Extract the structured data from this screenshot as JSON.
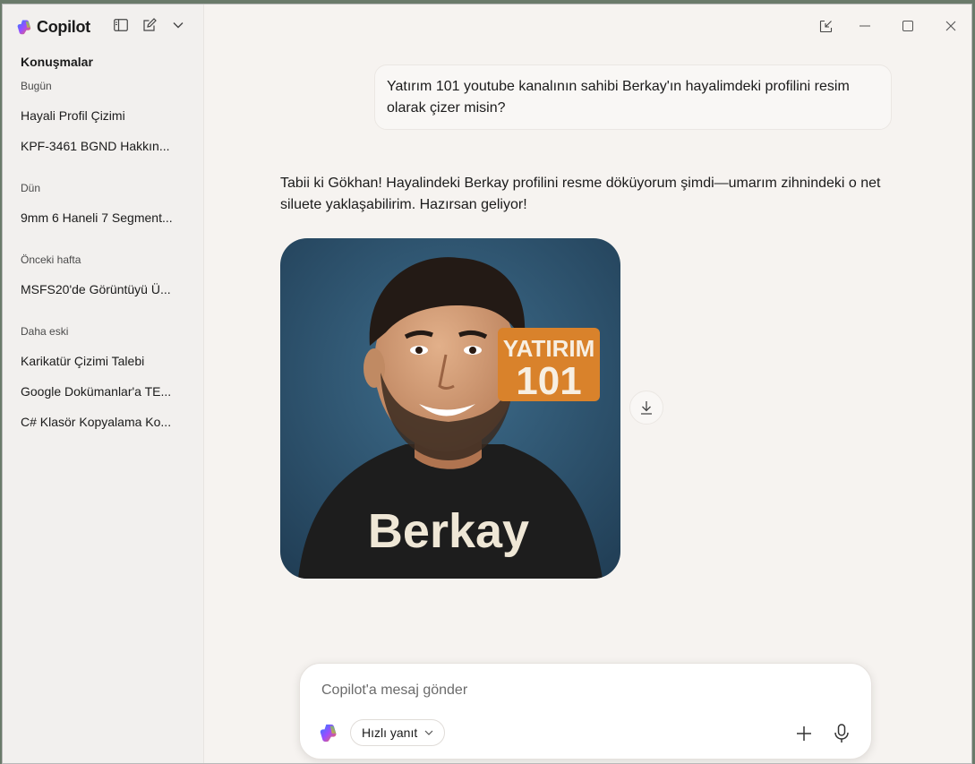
{
  "app": {
    "name": "Copilot"
  },
  "sidebar": {
    "heading": "Konuşmalar",
    "groups": [
      {
        "label": "Bugün",
        "items": [
          "Hayali Profil Çizimi",
          "KPF-3461 BGND Hakkın..."
        ]
      },
      {
        "label": "Dün",
        "items": [
          "9mm 6 Haneli 7 Segment..."
        ]
      },
      {
        "label": "Önceki hafta",
        "items": [
          "MSFS20'de Görüntüyü Ü..."
        ]
      },
      {
        "label": "Daha eski",
        "items": [
          "Karikatür Çizimi Talebi",
          "Google Dokümanlar'a TE...",
          "C# Klasör Kopyalama Ko..."
        ]
      }
    ]
  },
  "chat": {
    "user_message": "Yatırım 101 youtube kanalının sahibi Berkay'ın hayalimdeki profilini resim olarak çizer misin?",
    "assistant_message": "Tabii ki Gökhan! Hayalindeki Berkay profilini resme döküyorum şimdi—umarım zihnindeki o net siluete yaklaşabilirim. Hazırsan geliyor!",
    "image": {
      "badge_line1": "YATIRIM",
      "badge_line2": "101",
      "caption": "Berkay"
    }
  },
  "composer": {
    "placeholder": "Copilot'a mesaj gönder",
    "mode_label": "Hızlı yanıt"
  },
  "colors": {
    "window_bg": "#f6f3f0",
    "sidebar_bg": "#f2f0ee",
    "badge_orange": "#d9822b",
    "image_bg": "#2f5a7a"
  }
}
